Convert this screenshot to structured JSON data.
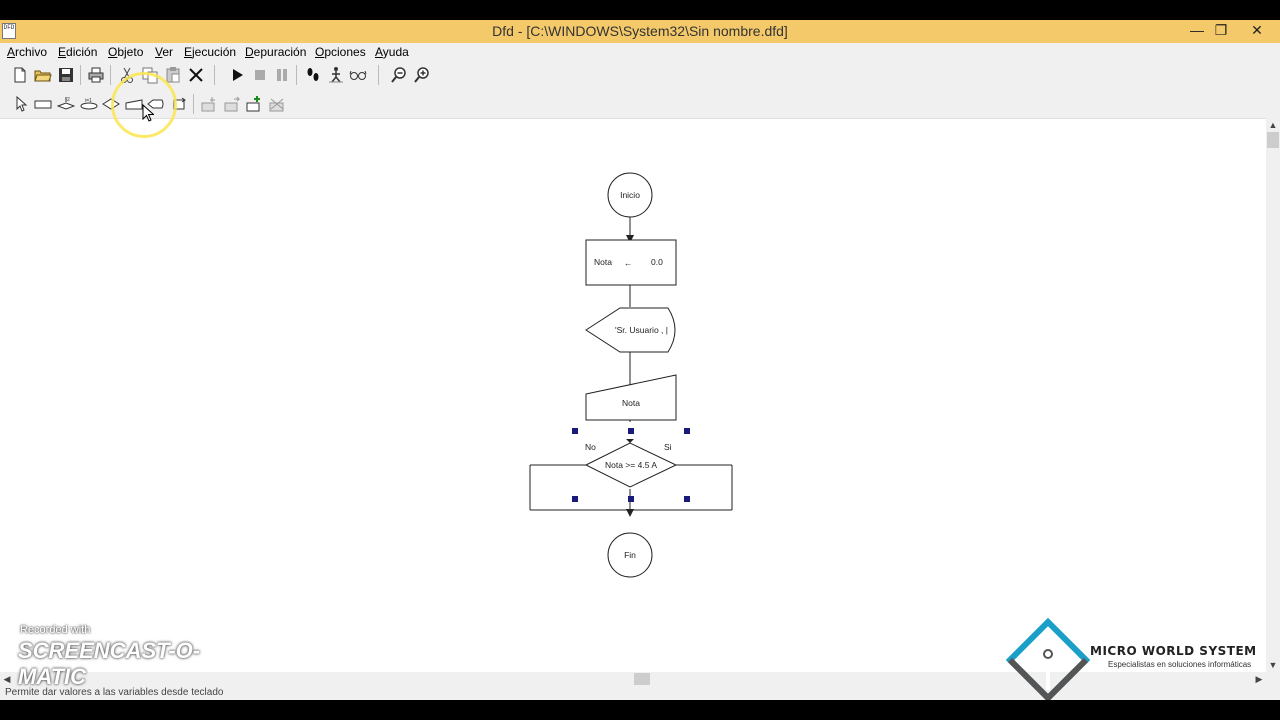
{
  "window": {
    "title": "Dfd - [C:\\WINDOWS\\System32\\Sin nombre.dfd]",
    "app_icon_text": "DFD",
    "controls": {
      "minimize": "—",
      "maximize": "❐",
      "close": "✕"
    }
  },
  "menubar": {
    "items": [
      {
        "label": "Archivo",
        "ul": "A",
        "rest": "rchivo"
      },
      {
        "label": "Edición",
        "ul": "E",
        "rest": "dición"
      },
      {
        "label": "Objeto",
        "ul": "O",
        "rest": "bjeto"
      },
      {
        "label": "Ver",
        "ul": "V",
        "rest": "er"
      },
      {
        "label": "Ejecución",
        "ul": "E",
        "rest": "jecución"
      },
      {
        "label": "Depuración",
        "ul": "D",
        "rest": "epuración"
      },
      {
        "label": "Opciones",
        "ul": "O",
        "rest": "pciones"
      },
      {
        "label": "Ayuda",
        "ul": "A",
        "rest": "yuda"
      }
    ]
  },
  "toolbar1": {
    "icons": [
      "new-file-icon",
      "open-folder-icon",
      "save-disk-icon",
      "print-icon",
      "cut-scissors-icon",
      "copy-icon",
      "paste-icon",
      "delete-x-icon",
      "run-play-icon",
      "stop-icon",
      "pause-icon",
      "step-footprints-icon",
      "step-walker-icon",
      "watch-glasses-icon",
      "zoom-out-icon",
      "zoom-in-icon"
    ]
  },
  "toolbar2": {
    "icons": [
      "select-cursor-icon",
      "assignment-rect-icon",
      "cycle-mientras-icon",
      "cycle-para-icon",
      "decision-diamond-icon",
      "read-input-icon",
      "write-output-icon",
      "subprogram-call-icon",
      "insert-subprogram-icon",
      "next-subprogram-icon",
      "new-subprogram-icon",
      "delete-subprogram-icon"
    ]
  },
  "flowchart": {
    "start_label": "Inicio",
    "assign_var": "Nota",
    "assign_arrow": "←",
    "assign_value": "0.0",
    "output_text": "'Sr. Usuario , |",
    "input_text": "Nota",
    "decision_text": "Nota >= 4.5 A",
    "branch_false": "No",
    "branch_true": "Si",
    "end_label": "Fin"
  },
  "statusbar": {
    "text": "Permite dar valores a las variables desde teclado"
  },
  "overlays": {
    "recorded_with": "Recorded with",
    "recorder_brand": "SCREENCAST-O-MATIC",
    "company_name": "MICRO WORLD SYSTEM",
    "company_tagline": "Especialistas en soluciones informáticas",
    "cursor_highlight_color": "#f5e050"
  },
  "colors": {
    "title_bar": "#f4c96a",
    "selection_handle": "#1a1a7a",
    "logo_blue": "#1aa0c8",
    "logo_gray": "#555555"
  }
}
